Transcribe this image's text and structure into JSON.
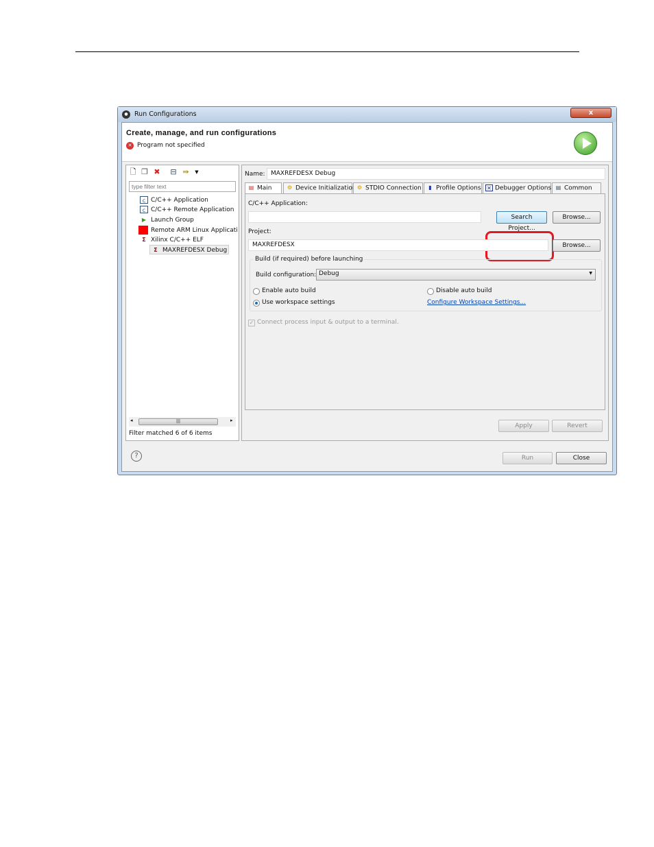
{
  "window": {
    "title": "Run Configurations",
    "close_label": "x"
  },
  "header": {
    "title": "Create, manage, and run configurations",
    "error": "Program not specified"
  },
  "left": {
    "filter_placeholder": "type filter text",
    "tree": [
      {
        "label": "C/C++ Application",
        "icon": "c-app-icon"
      },
      {
        "label": "C/C++ Remote Application",
        "icon": "c-app-icon"
      },
      {
        "label": "Launch Group",
        "icon": "launch-group-icon"
      },
      {
        "label": "Remote ARM Linux Applicati",
        "icon": "remote-arm-icon"
      },
      {
        "label": "Xilinx C/C++ ELF",
        "icon": "xilinx-icon"
      },
      {
        "label": "MAXREFDESX Debug",
        "icon": "xilinx-icon",
        "selected": true
      }
    ],
    "status": "Filter matched 6 of 6 items"
  },
  "right": {
    "name_label": "Name:",
    "name_value": "MAXREFDESX Debug",
    "tabs": [
      {
        "label": "Main",
        "active": true
      },
      {
        "label": "Device Initialization"
      },
      {
        "label": "STDIO Connection"
      },
      {
        "label": "Profile Options"
      },
      {
        "label": "Debugger Options"
      },
      {
        "label": "Common"
      }
    ],
    "app_label": "C/C++ Application:",
    "app_value": "",
    "search_project": "Search Project...",
    "browse": "Browse...",
    "project_label": "Project:",
    "project_value": "MAXREFDESX",
    "build_group": "Build (if required) before launching",
    "build_config_label": "Build configuration:",
    "build_config_value": "Debug",
    "enable_auto": "Enable auto build",
    "disable_auto": "Disable auto build",
    "use_workspace": "Use workspace settings",
    "configure_link": "Configure Workspace Settings...",
    "connect_terminal": "Connect process input & output to a terminal.",
    "apply": "Apply",
    "revert": "Revert"
  },
  "footer": {
    "help": "?",
    "run": "Run",
    "close": "Close"
  },
  "colors": {
    "highlight_ring": "#e41820",
    "link": "#0645ad"
  }
}
